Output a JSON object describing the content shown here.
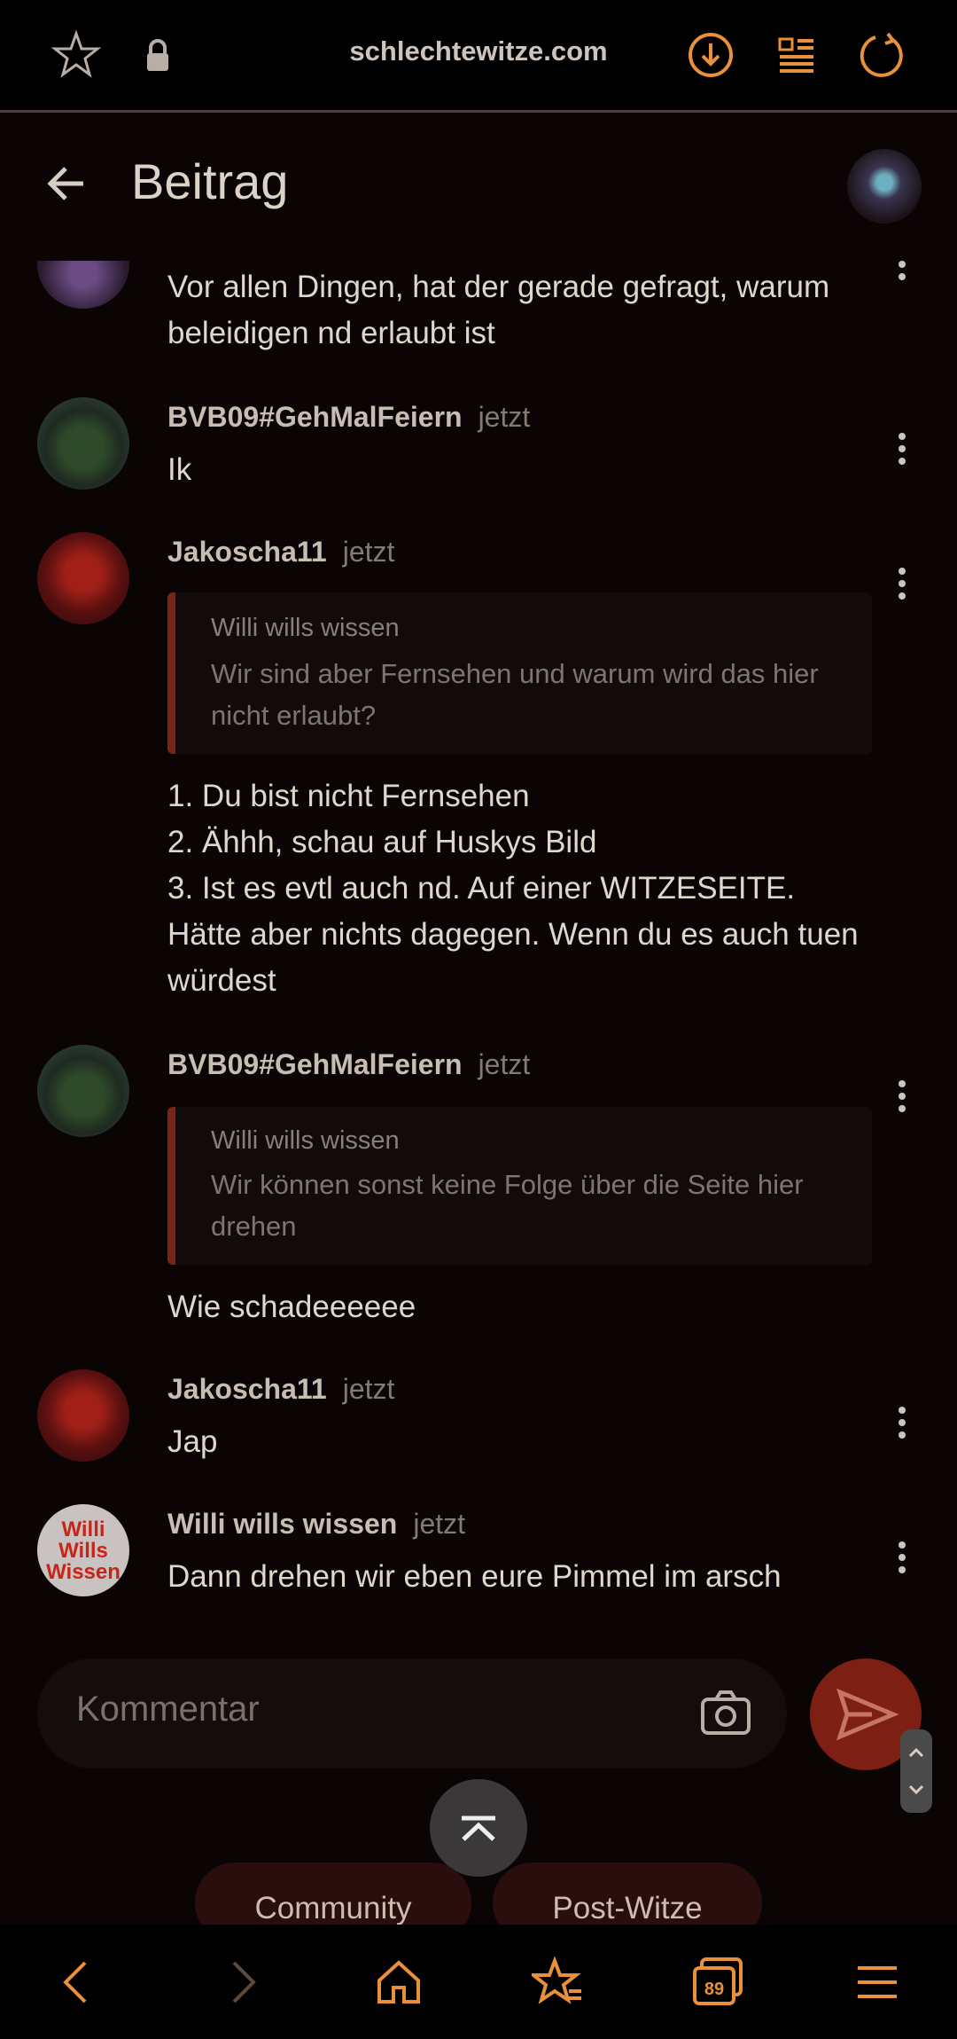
{
  "browser": {
    "url": "schlechtewitze.com"
  },
  "header": {
    "title": "Beitrag"
  },
  "comments": [
    {
      "author": "",
      "time": "",
      "text": "Vor allen Dingen, hat der gerade gefragt, warum beleidigen nd erlaubt ist"
    },
    {
      "author": "BVB09#GehMalFeiern",
      "time": "jetzt",
      "text": "Ik"
    },
    {
      "author": "Jakoscha11",
      "time": "jetzt",
      "quote": {
        "author": "Willi wills wissen",
        "text": "Wir sind aber Fernsehen und warum wird das hier nicht erlaubt?"
      },
      "lines": [
        "1. Du bist nicht Fernsehen",
        "2. Ähhh, schau auf Huskys Bild",
        "3. Ist es evtl auch nd. Auf einer WITZESEITE.",
        "Hätte aber nichts dagegen. Wenn du es auch tuen würdest"
      ]
    },
    {
      "author": "BVB09#GehMalFeiern",
      "time": "jetzt",
      "quote": {
        "author": "Willi wills wissen",
        "text": "Wir können sonst keine Folge über die Seite hier drehen"
      },
      "text": "Wie schadeeeeee"
    },
    {
      "author": "Jakoscha11",
      "time": "jetzt",
      "text": "Jap"
    },
    {
      "author": "Willi wills wissen",
      "time": "jetzt",
      "text": "Dann drehen wir eben eure Pimmel im arsch"
    }
  ],
  "avatar_willi_lines": [
    "Willi",
    "Wills",
    "Wissen"
  ],
  "comment_input": {
    "placeholder": "Kommentar"
  },
  "tabs": {
    "community": "Community",
    "post_witze": "Post-Witze"
  },
  "bottom_nav": {
    "tabs_count": "89"
  },
  "colors": {
    "accent": "#e8903a",
    "background": "#0a0404",
    "send_button": "#7e1f14",
    "quote_bar": "#7a2418"
  },
  "icons": [
    "star-icon",
    "lock-icon",
    "download-icon",
    "reader-icon",
    "reload-icon",
    "back-arrow-icon",
    "more-icon",
    "camera-icon",
    "send-icon",
    "scroll-top-icon",
    "nav-back-icon",
    "nav-forward-icon",
    "home-icon",
    "bookmarks-icon",
    "tabs-icon",
    "menu-icon"
  ]
}
